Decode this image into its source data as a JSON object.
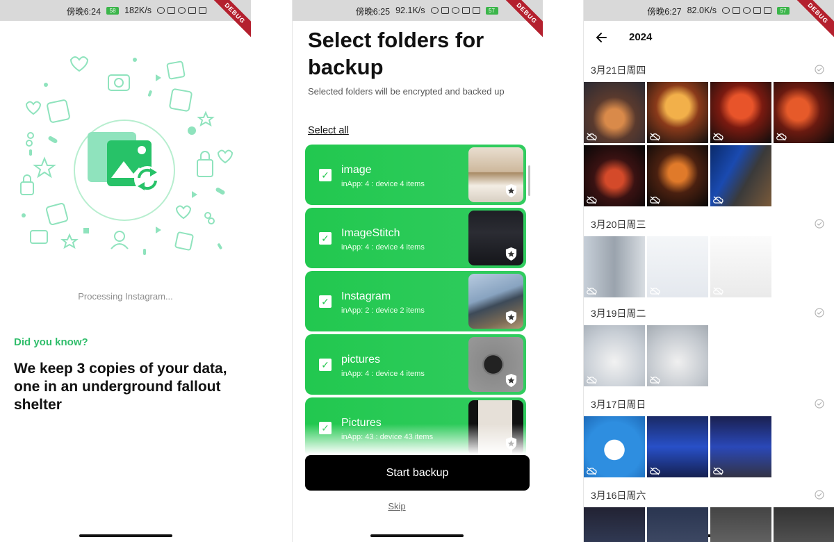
{
  "screens": [
    {
      "status": {
        "time": "傍晚6:24",
        "speed": "182K/s",
        "battery": "58"
      },
      "debug_label": "DEBUG",
      "processing_text": "Processing Instagram...",
      "did_you_know": "Did you know?",
      "fact": "We keep 3 copies of your data, one in an underground fallout shelter"
    },
    {
      "status": {
        "time": "傍晚6:25",
        "speed": "92.1K/s",
        "battery": "57"
      },
      "debug_label": "DEBUG",
      "title": "Select folders for backup",
      "subtitle": "Selected folders will be encrypted and backed up",
      "select_all": "Select all",
      "folders": [
        {
          "name": "image",
          "count": "inApp: 4 : device 4 items",
          "checked": true
        },
        {
          "name": "ImageStitch",
          "count": "inApp: 4 : device 4 items",
          "checked": true
        },
        {
          "name": "Instagram",
          "count": "inApp: 2 : device 2 items",
          "checked": true
        },
        {
          "name": "pictures",
          "count": "inApp: 4 : device 4 items",
          "checked": true
        },
        {
          "name": "Pictures",
          "count": "inApp: 43 : device 43 items",
          "checked": true
        }
      ],
      "start_backup": "Start backup",
      "skip": "Skip"
    },
    {
      "status": {
        "time": "傍晚6:27",
        "speed": "82.0K/s",
        "battery": "57"
      },
      "debug_label": "DEBUG",
      "year": "2024",
      "days": [
        {
          "label": "3月21日周四",
          "photo_count": 7
        },
        {
          "label": "3月20日周三",
          "photo_count": 3
        },
        {
          "label": "3月19日周二",
          "photo_count": 2
        },
        {
          "label": "3月17日周日",
          "photo_count": 3
        },
        {
          "label": "3月16日周六",
          "photo_count": 4
        }
      ]
    }
  ],
  "colors": {
    "accent": "#22c84f",
    "text_green": "#2fbd6a",
    "illustration": "#8fe3bd"
  }
}
